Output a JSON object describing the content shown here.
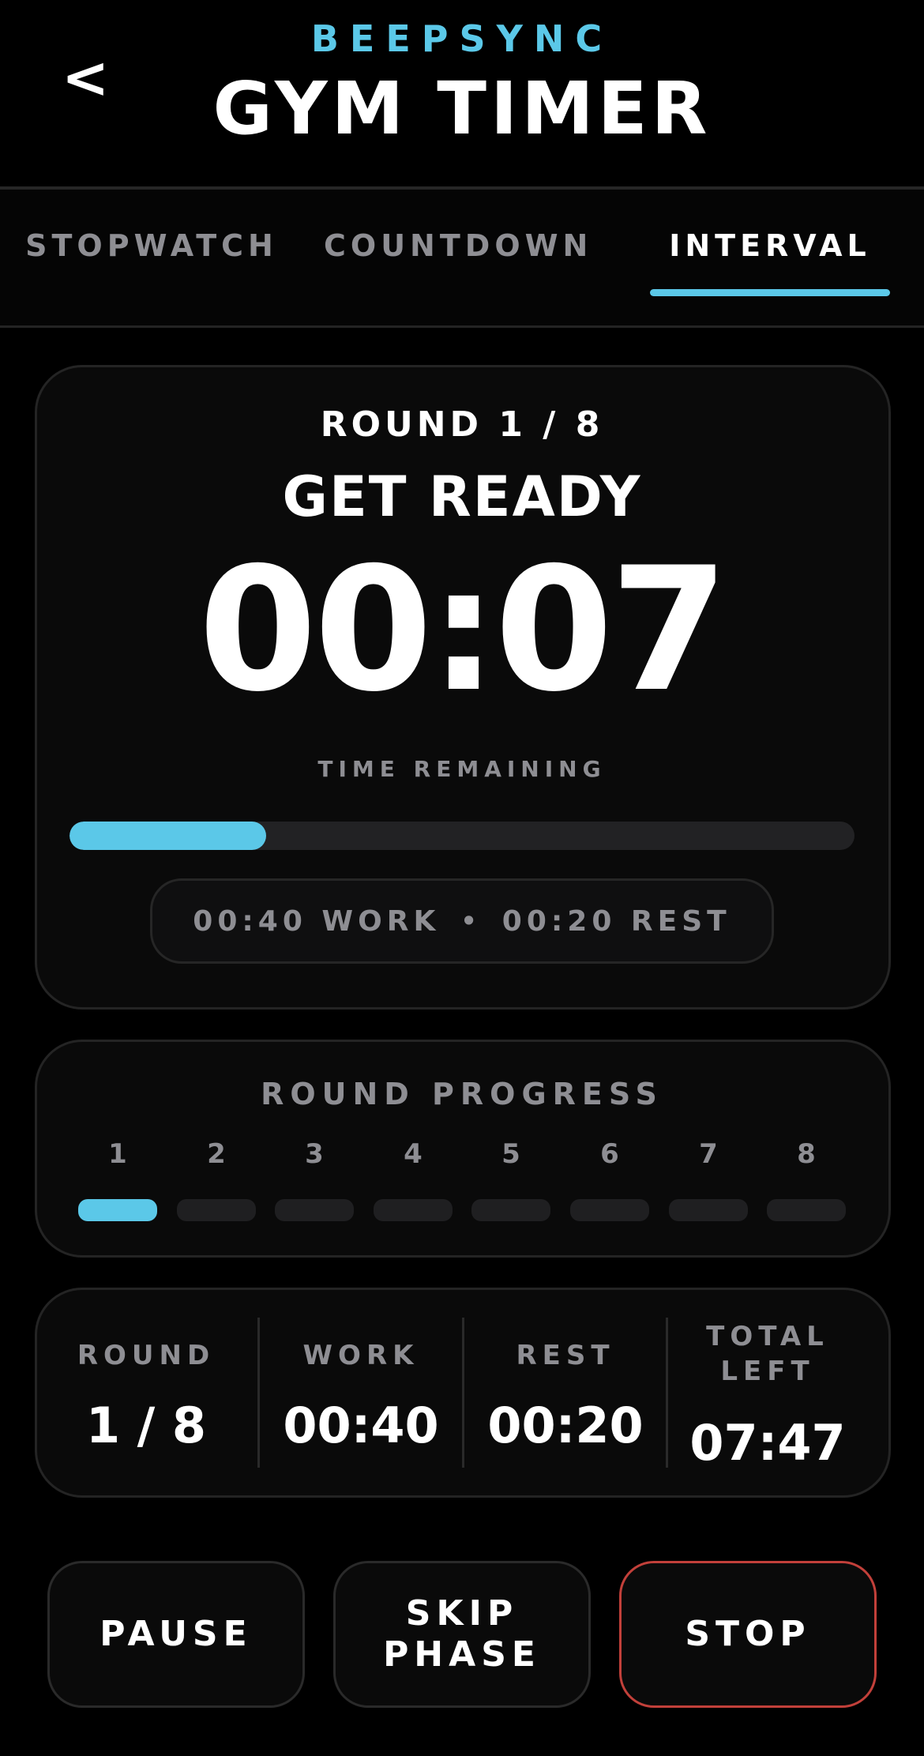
{
  "header": {
    "back_label": "<",
    "brand": "BEEPSYNC",
    "title": "GYM TIMER"
  },
  "tabs": [
    {
      "label": "STOPWATCH",
      "active": false
    },
    {
      "label": "COUNTDOWN",
      "active": false
    },
    {
      "label": "INTERVAL",
      "active": true
    }
  ],
  "timer": {
    "round_label": "ROUND 1 / 8",
    "phase": "GET READY",
    "time": "00:07",
    "time_caption": "TIME REMAINING",
    "progress_fraction": 0.25,
    "work_text": "00:40 WORK",
    "separator": "•",
    "rest_text": "00:20 REST"
  },
  "round_progress": {
    "title": "ROUND PROGRESS",
    "rounds": [
      "1",
      "2",
      "3",
      "4",
      "5",
      "6",
      "7",
      "8"
    ],
    "completed_active": 1
  },
  "stats": [
    {
      "label": "ROUND",
      "value": "1 / 8"
    },
    {
      "label": "WORK",
      "value": "00:40"
    },
    {
      "label": "REST",
      "value": "00:20"
    },
    {
      "label": "TOTAL LEFT",
      "value": "07:47"
    }
  ],
  "buttons": {
    "pause": "PAUSE",
    "skip": "SKIP PHASE",
    "stop": "STOP"
  },
  "colors": {
    "accent": "#5bc8e8",
    "stop_border": "#c2403a",
    "muted": "#8e8e93",
    "background": "#000000"
  }
}
